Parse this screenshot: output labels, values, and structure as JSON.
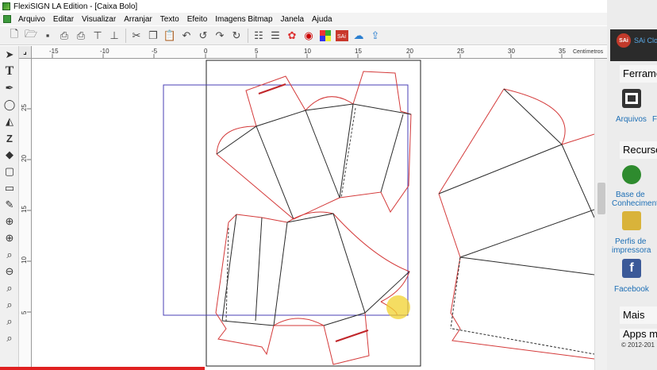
{
  "window": {
    "title": "FlexiSIGN LA Edition - [Caixa Bolo]"
  },
  "menu": {
    "items": [
      "Arquivo",
      "Editar",
      "Visualizar",
      "Arranjar",
      "Texto",
      "Efeito",
      "Imagens Bitmap",
      "Janela",
      "Ajuda"
    ]
  },
  "toolbar": {
    "buttons": [
      "new-icon",
      "open-icon",
      "save-icon",
      "print-setup-icon",
      "print-icon",
      "cut-plot-icon",
      "scissors-icon",
      "copy-icon",
      "paste-icon",
      "undo-icon",
      "undo-all-icon",
      "redo-icon",
      "redo-all-icon",
      "properties-icon",
      "job-info-icon",
      "color-wheel-icon",
      "color-picker-icon",
      "swatch-icon",
      "sai-icon",
      "cloud-icon",
      "upload-cloud-icon"
    ]
  },
  "ruler": {
    "unit_label": "Centímetros",
    "h_ticks": [
      "-15",
      "-10",
      "-5",
      "0",
      "5",
      "10",
      "15",
      "20",
      "25",
      "30",
      "35"
    ],
    "v_ticks": [
      "25",
      "20",
      "15",
      "10",
      "5"
    ]
  },
  "side_panel": {
    "brand": "SAi Cloud",
    "logo": "SAi",
    "section_tools": "Ferramentas",
    "item_files": "Arquivos",
    "item_files_2": "F",
    "section_resources": "Recursos",
    "item_knowledge_1": "Base de",
    "item_knowledge_2": "Conhecimento",
    "item_printer_1": "Perfis de",
    "item_printer_2": "impressora",
    "item_facebook": "Facebook",
    "section_more": "Mais",
    "section_apps": "Apps m",
    "copyright": "© 2012-201"
  },
  "colors": {
    "cut_red": "#d43a3a",
    "fold_dark": "#2a2a2a",
    "selection_blue": "#4a3fb5",
    "cursor_yellow": "#f2d22e"
  }
}
